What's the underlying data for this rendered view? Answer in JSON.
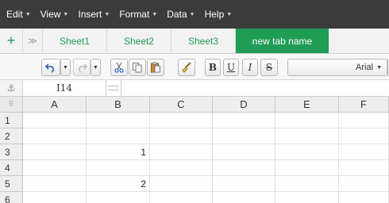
{
  "menubar": {
    "items": [
      {
        "label": "Edit"
      },
      {
        "label": "View"
      },
      {
        "label": "Insert"
      },
      {
        "label": "Format"
      },
      {
        "label": "Data"
      },
      {
        "label": "Help"
      }
    ],
    "background": "#3b3b3b"
  },
  "tabs": {
    "add_icon": "plus-icon",
    "list_icon": "chevron-double-down-icon",
    "items": [
      {
        "label": "Sheet1",
        "active": false
      },
      {
        "label": "Sheet2",
        "active": false
      },
      {
        "label": "Sheet3",
        "active": false
      },
      {
        "label": "new tab name",
        "active": true
      }
    ],
    "accent": "#1f9d55"
  },
  "toolbar": {
    "undo_icon": "undo-icon",
    "redo_icon": "redo-icon",
    "cut_icon": "scissors-icon",
    "copy_icon": "copy-icon",
    "paste_icon": "paste-icon",
    "format_painter_icon": "paintbrush-icon",
    "bold_label": "B",
    "underline_label": "U",
    "italic_label": "I",
    "strike_label": "S",
    "font_name": "Arial"
  },
  "formula_bar": {
    "anchor_icon": "anchor-icon",
    "cell_ref": "I14"
  },
  "grid": {
    "corner_icon": "grid-dots-icon",
    "columns": [
      "A",
      "B",
      "C",
      "D",
      "E",
      "F"
    ],
    "rows": [
      "1",
      "2",
      "3",
      "4",
      "5",
      "6"
    ],
    "cells": {
      "B3": "1",
      "B5": "2"
    }
  }
}
